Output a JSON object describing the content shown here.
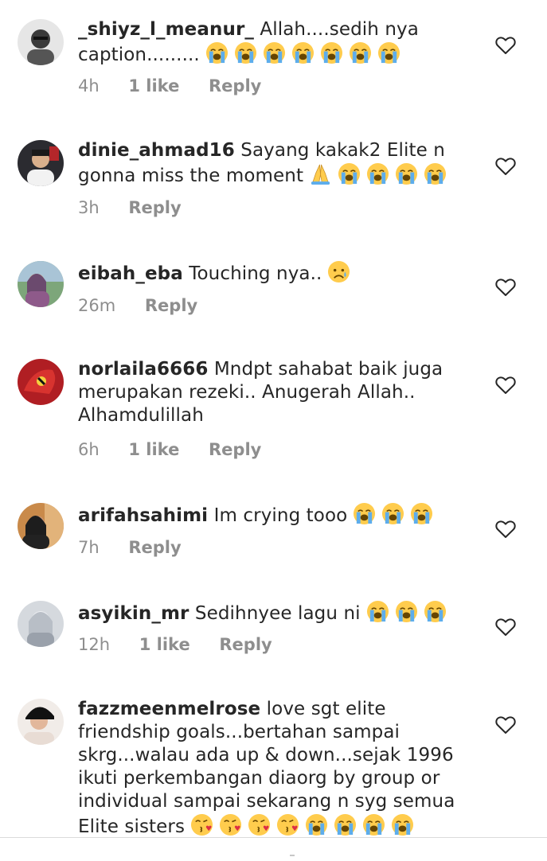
{
  "colors": {
    "text": "#262626",
    "meta": "#8e8e8e",
    "divider": "#dbdbdb",
    "emoji": "#ffcc4d",
    "tear": "#5dadec"
  },
  "comments": [
    {
      "username": "_shiyz_l_meanur_",
      "text": "Allah....sedih nya caption.........",
      "emojis": [
        "loudly-crying",
        "loudly-crying",
        "loudly-crying",
        "loudly-crying",
        "loudly-crying",
        "loudly-crying",
        "loudly-crying"
      ],
      "time": "4h",
      "likes": "1 like",
      "reply": "Reply"
    },
    {
      "username": "dinie_ahmad16",
      "text": "Sayang kakak2 Elite n gonna miss the moment",
      "emojis": [
        "folded-hands",
        "loudly-crying",
        "loudly-crying",
        "loudly-crying",
        "loudly-crying"
      ],
      "time": "3h",
      "likes": "",
      "reply": "Reply"
    },
    {
      "username": "eibah_eba",
      "text": "Touching nya..",
      "emojis": [
        "sad-but-relieved"
      ],
      "time": "26m",
      "likes": "",
      "reply": "Reply"
    },
    {
      "username": "norlaila6666",
      "text": "Mndpt sahabat baik juga merupakan rezeki.. Anugerah Allah.. Alhamdulillah",
      "emojis": [],
      "time": "6h",
      "likes": "1 like",
      "reply": "Reply"
    },
    {
      "username": "arifahsahimi",
      "text": "Im crying tooo",
      "emojis": [
        "loudly-crying",
        "loudly-crying",
        "loudly-crying"
      ],
      "time": "7h",
      "likes": "",
      "reply": "Reply"
    },
    {
      "username": "asyikin_mr",
      "text": "Sedihnyee lagu ni",
      "emojis": [
        "loudly-crying",
        "loudly-crying",
        "loudly-crying"
      ],
      "time": "12h",
      "likes": "1 like",
      "reply": "Reply"
    },
    {
      "username": "fazzmeenmelrose",
      "text": "love sgt elite friendship goals...bertahan sampai skrg...walau ada up & down...sejak 1996 ikuti perkembangan diaorg by group or individual sampai sekarang n syg semua Elite sisters",
      "emojis": [
        "face-blowing-kiss",
        "face-blowing-kiss",
        "face-blowing-kiss",
        "face-blowing-kiss",
        "loudly-crying",
        "loudly-crying",
        "loudly-crying",
        "loudly-crying"
      ],
      "time": "",
      "likes": "",
      "reply": ""
    }
  ],
  "icons": {
    "like": "heart-outline-icon"
  }
}
